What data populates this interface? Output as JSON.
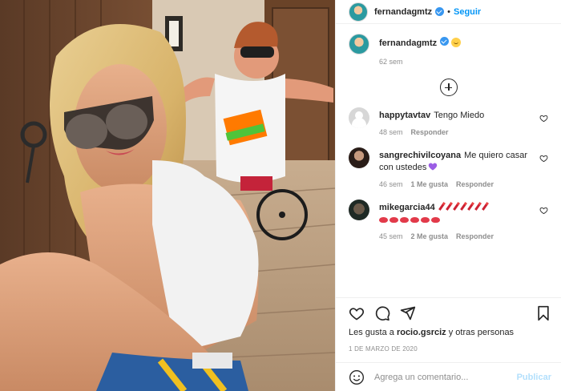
{
  "post": {
    "username": "fernandagmtz",
    "follow_label": "Seguir",
    "separator": "•",
    "caption_time": "62 sem",
    "likes_prefix": "Les gusta a ",
    "likes_user": "rocio.gsrciz",
    "likes_suffix": " y otras personas",
    "date": "1 DE MARZO DE 2020",
    "comment_placeholder": "Agrega un comentario...",
    "publish_label": "Publicar"
  },
  "comments": [
    {
      "user": "happytavtav",
      "text": "Tengo Miedo",
      "time": "48 sem",
      "likes": "",
      "reply": "Responder"
    },
    {
      "user": "sangrechivilcoyana",
      "text": "Me quiero casar con ustedes",
      "time": "46 sem",
      "likes": "1 Me gusta",
      "reply": "Responder"
    },
    {
      "user": "mikegarcia44",
      "text": "",
      "time": "45 sem",
      "likes": "2 Me gusta",
      "reply": "Responder"
    }
  ],
  "colors": {
    "accent": "#0095f6",
    "verified": "#3897f0",
    "muted": "#8e8e8e",
    "post_disabled": "#b2dffc"
  },
  "icons": [
    "verified-badge-icon",
    "smiley-emoji-icon",
    "plus-circle-icon",
    "heart-icon",
    "comment-icon",
    "share-icon",
    "bookmark-icon",
    "emoji-icon",
    "purple-heart-icon",
    "lipstick-icon",
    "lips-icon"
  ]
}
